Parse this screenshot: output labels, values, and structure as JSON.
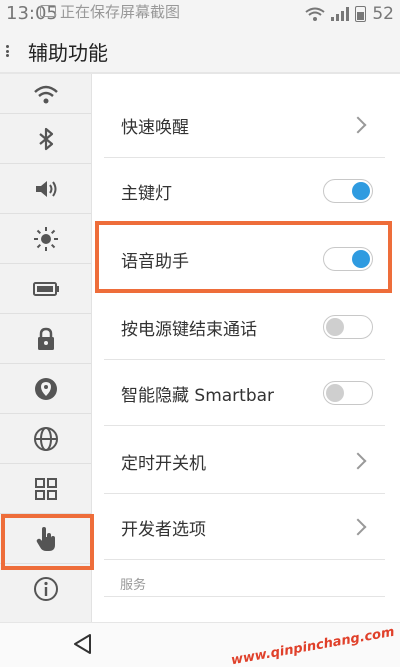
{
  "status_bar": {
    "time": "13:05",
    "notification": "正在保存屏幕截图",
    "battery_level": "52"
  },
  "title_bar": {
    "title": "辅助功能"
  },
  "sidebar": {
    "icons": [
      "wifi-icon",
      "bluetooth-icon",
      "volume-icon",
      "brightness-icon",
      "battery-icon",
      "lock-icon",
      "location-icon",
      "globe-icon",
      "grid-icon",
      "hand-pointer-icon",
      "info-icon"
    ],
    "active_index": 9
  },
  "settings": {
    "items": [
      {
        "label": "快速唤醒",
        "control": "chevron"
      },
      {
        "label": "主键灯",
        "control": "toggle",
        "on": true
      },
      {
        "label": "语音助手",
        "control": "toggle",
        "on": true
      },
      {
        "label": "按电源键结束通话",
        "control": "toggle",
        "on": false
      },
      {
        "label": "智能隐藏 Smartbar",
        "control": "toggle",
        "on": false
      },
      {
        "label": "定时开关机",
        "control": "chevron"
      },
      {
        "label": "开发者选项",
        "control": "chevron"
      }
    ],
    "section_header": "服务"
  },
  "nav_bar": {
    "watermark": "www.qinpinchang.com"
  },
  "colors": {
    "accent": "#2f9be0",
    "highlight": "#ee6d3a"
  }
}
